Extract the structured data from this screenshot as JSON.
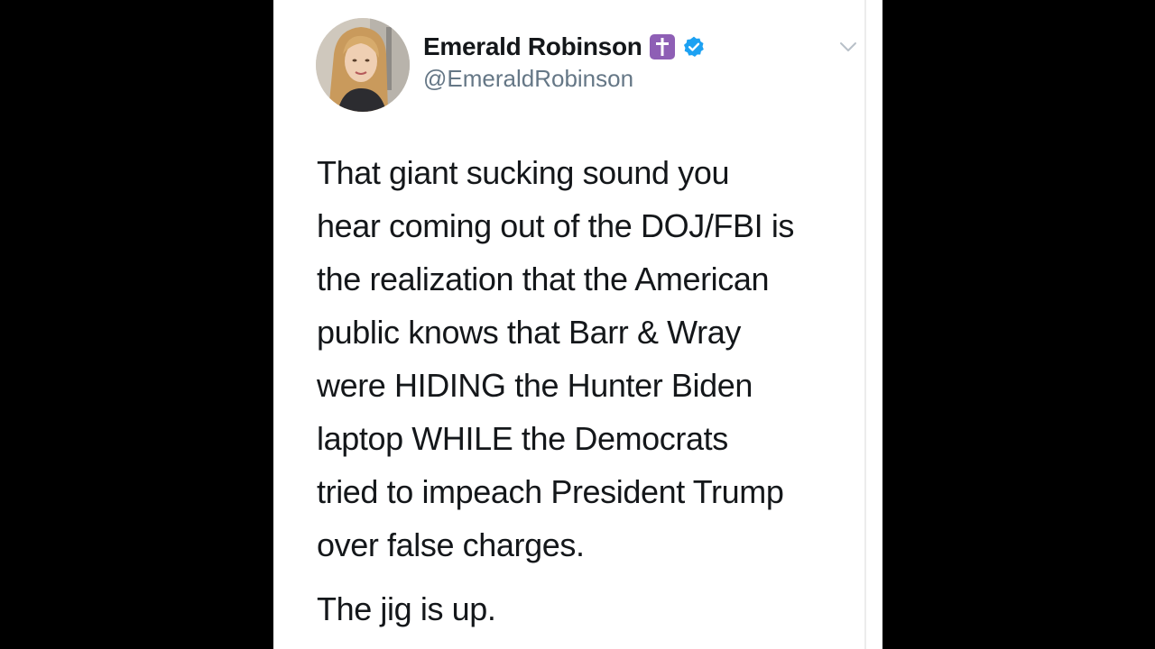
{
  "tweet": {
    "author": {
      "display_name": "Emerald Robinson",
      "handle": "@EmeraldRobinson",
      "badges": [
        "latin-cross-emoji",
        "verified-check"
      ],
      "badge_colors": {
        "cross_badge_bg": "#8e5fb5",
        "verified": "#1da1f2"
      }
    },
    "body_lines": [
      "That giant sucking sound you",
      "hear coming out of the DOJ/FBI is",
      "the realization that the American",
      "public knows that Barr & Wray",
      "were HIDING the Hunter Biden",
      "laptop WHILE the Democrats",
      "tried to impeach President Trump",
      "over false charges."
    ],
    "closing_line": "The jig is up.",
    "menu_icon": "chevron-down-icon"
  },
  "colors": {
    "letterbox": "#000000",
    "card_background": "#ffffff",
    "text_primary": "#14171a",
    "text_secondary": "#657786"
  }
}
